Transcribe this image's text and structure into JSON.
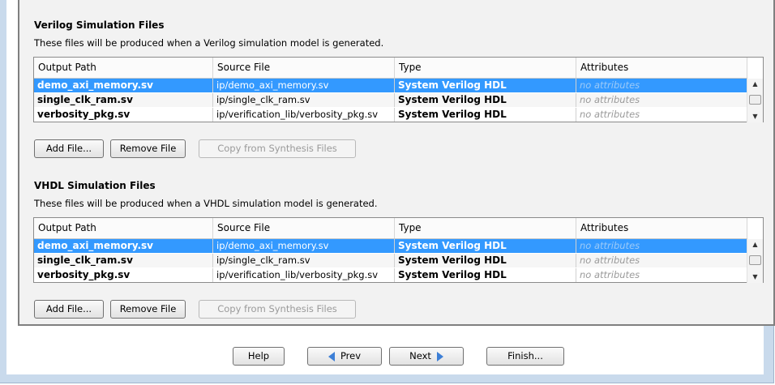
{
  "verilog": {
    "title": "Verilog Simulation Files",
    "description": "These files will be produced when a Verilog simulation model is generated.",
    "columns": [
      "Output Path",
      "Source File",
      "Type",
      "Attributes"
    ],
    "rows": [
      {
        "output": "demo_axi_memory.sv",
        "source": "ip/demo_axi_memory.sv",
        "type": "System Verilog HDL",
        "attributes": "no attributes",
        "selected": true
      },
      {
        "output": "single_clk_ram.sv",
        "source": "ip/single_clk_ram.sv",
        "type": "System Verilog HDL",
        "attributes": "no attributes",
        "selected": false
      },
      {
        "output": "verbosity_pkg.sv",
        "source": "ip/verification_lib/verbosity_pkg.sv",
        "type": "System Verilog HDL",
        "attributes": "no attributes",
        "selected": false
      }
    ],
    "buttons": {
      "add": "Add File...",
      "remove": "Remove File",
      "copy": "Copy from Synthesis Files"
    }
  },
  "vhdl": {
    "title": "VHDL Simulation Files",
    "description": "These files will be produced when a VHDL simulation model is generated.",
    "columns": [
      "Output Path",
      "Source File",
      "Type",
      "Attributes"
    ],
    "rows": [
      {
        "output": "demo_axi_memory.sv",
        "source": "ip/demo_axi_memory.sv",
        "type": "System Verilog HDL",
        "attributes": "no attributes",
        "selected": true
      },
      {
        "output": "single_clk_ram.sv",
        "source": "ip/single_clk_ram.sv",
        "type": "System Verilog HDL",
        "attributes": "no attributes",
        "selected": false
      },
      {
        "output": "verbosity_pkg.sv",
        "source": "ip/verification_lib/verbosity_pkg.sv",
        "type": "System Verilog HDL",
        "attributes": "no attributes",
        "selected": false
      }
    ],
    "buttons": {
      "add": "Add File...",
      "remove": "Remove File",
      "copy": "Copy from Synthesis Files"
    }
  },
  "nav": {
    "help": "Help",
    "prev": "Prev",
    "next": "Next",
    "finish": "Finish..."
  },
  "colors": {
    "selection": "#3399ff",
    "frame": "#c9daec",
    "arrow": "#3d7fd6"
  }
}
